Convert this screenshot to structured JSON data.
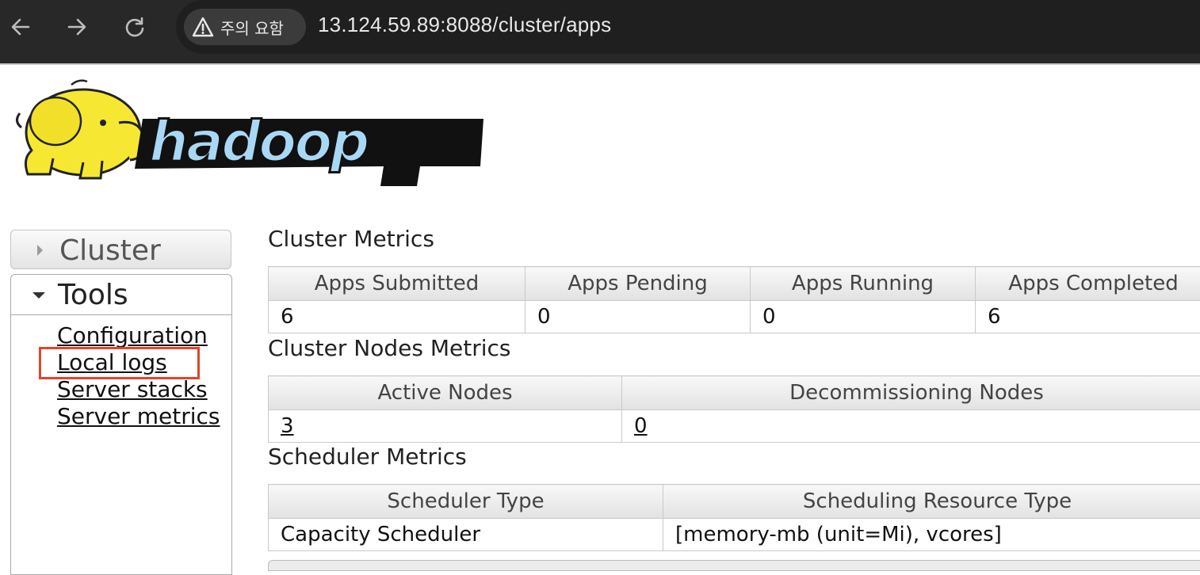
{
  "browser": {
    "warning_label": "주의 요함",
    "url": "13.124.59.89:8088/cluster/apps"
  },
  "logo": {
    "text": "hadoop"
  },
  "sidebar": {
    "cluster_label": "Cluster",
    "tools_label": "Tools",
    "tools_links": [
      "Configuration",
      "Local logs",
      "Server stacks",
      "Server metrics"
    ]
  },
  "cluster_metrics": {
    "title": "Cluster Metrics",
    "headers": [
      "Apps Submitted",
      "Apps Pending",
      "Apps Running",
      "Apps Completed"
    ],
    "values": [
      "6",
      "0",
      "0",
      "6"
    ]
  },
  "cluster_nodes_metrics": {
    "title": "Cluster Nodes Metrics",
    "headers": [
      "Active Nodes",
      "Decommissioning Nodes"
    ],
    "values": [
      "3",
      "0"
    ]
  },
  "scheduler_metrics": {
    "title": "Scheduler Metrics",
    "headers": [
      "Scheduler Type",
      "Scheduling Resource Type"
    ],
    "values": [
      "Capacity Scheduler",
      "[memory-mb (unit=Mi), vcores]"
    ]
  },
  "colors": {
    "highlight": "#e0452a",
    "chrome": "#282828"
  },
  "icons": [
    "back-arrow-icon",
    "forward-arrow-icon",
    "reload-icon",
    "warning-icon",
    "hadoop-elephant-icon"
  ]
}
